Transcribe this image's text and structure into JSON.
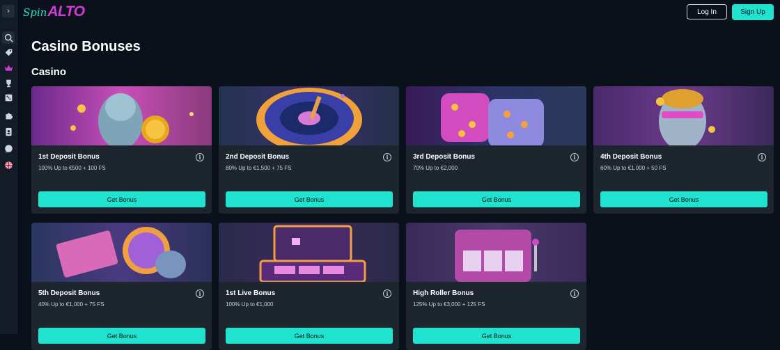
{
  "header": {
    "logo_spin": "Spin",
    "logo_alto": "ALTO",
    "login_label": "Log In",
    "signup_label": "Sign Up"
  },
  "page": {
    "title": "Casino Bonuses",
    "section": "Casino"
  },
  "sidebar": {
    "icons": [
      "search-icon",
      "tag-icon",
      "crown-icon",
      "trophy-icon",
      "dice-icon",
      "puzzle-icon",
      "card-icon",
      "chat-icon",
      "uk-flag-icon"
    ]
  },
  "bonuses": [
    {
      "name": "1st Deposit Bonus",
      "desc": "100% Up to €500 + 100 FS",
      "button": "Get Bonus"
    },
    {
      "name": "2nd Deposit Bonus",
      "desc": "80% Up to €1,500 + 75 FS",
      "button": "Get Bonus"
    },
    {
      "name": "3rd Deposit Bonus",
      "desc": "70% Up to €2,000",
      "button": "Get Bonus"
    },
    {
      "name": "4th Deposit Bonus",
      "desc": "60% Up to €1,000 + 50 FS",
      "button": "Get Bonus"
    },
    {
      "name": "5th Deposit Bonus",
      "desc": "40% Up to €1,000 + 75 FS",
      "button": "Get Bonus"
    },
    {
      "name": "1st Live Bonus",
      "desc": "100% Up to €1,000",
      "button": "Get Bonus"
    },
    {
      "name": "High Roller Bonus",
      "desc": "125% Up to €3,000 + 125 FS",
      "button": "Get Bonus"
    }
  ],
  "colors": {
    "background": "#0b111a",
    "card": "#1d252f",
    "accent": "#1fe3cf",
    "logo_pink": "#d23bd8"
  }
}
